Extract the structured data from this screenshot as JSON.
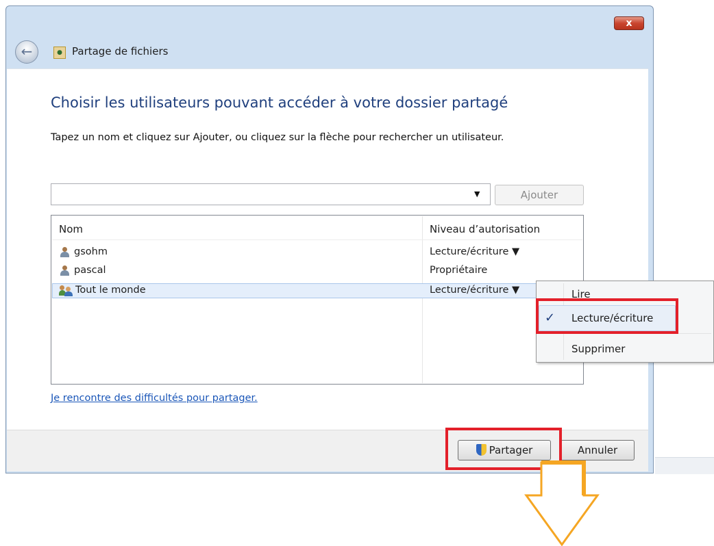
{
  "window": {
    "title": "Partage de fichiers",
    "close_label": "x"
  },
  "main": {
    "heading": "Choisir les utilisateurs pouvant accéder à votre dossier partagé",
    "instruction": "Tapez un nom et cliquez sur Ajouter, ou cliquez sur la flèche pour rechercher un utilisateur.",
    "name_input": {
      "value": "",
      "placeholder": ""
    },
    "add_button": "Ajouter"
  },
  "table": {
    "columns": [
      "Nom",
      "Niveau d’autorisation"
    ],
    "rows": [
      {
        "name": "gsohm",
        "level": "Lecture/écriture ▼",
        "icon": "user-icon"
      },
      {
        "name": "pascal",
        "level": "Propriétaire",
        "icon": "user-icon"
      },
      {
        "name": "Tout le monde",
        "level": "Lecture/écriture ▼",
        "icon": "group-icon",
        "selected": true
      }
    ]
  },
  "menu": {
    "items": [
      "Lire",
      "Lecture/écriture",
      "Supprimer"
    ],
    "checked": "Lecture/écriture"
  },
  "help_link": "Je rencontre des difficultés pour partager.",
  "footer": {
    "share_button": "Partager",
    "cancel_button": "Annuler"
  },
  "colors": {
    "highlight": "#e3202a",
    "arrow": "#f5a623",
    "heading": "#1f3f7d",
    "link": "#1a56b8"
  }
}
